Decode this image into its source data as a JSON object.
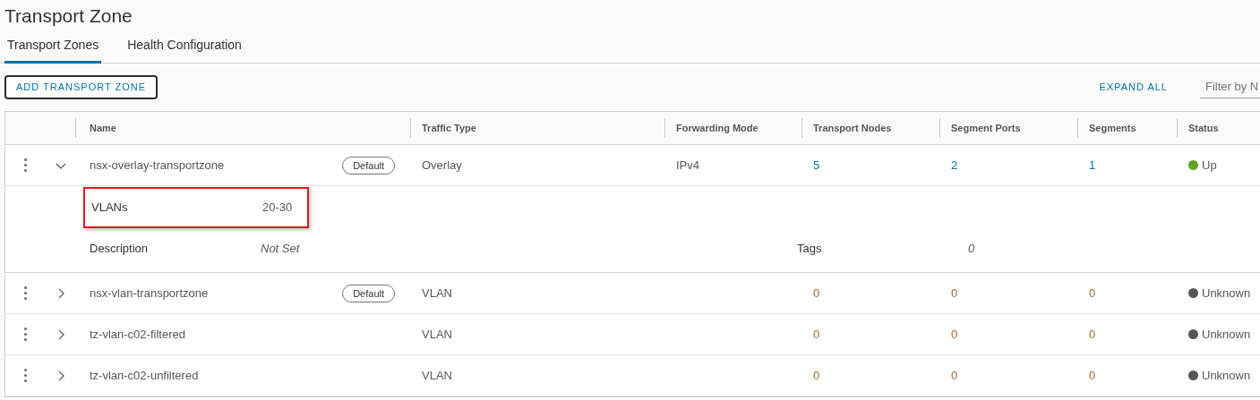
{
  "page": {
    "title": "Transport Zone"
  },
  "tabs": [
    {
      "label": "Transport Zones",
      "selected": true
    },
    {
      "label": "Health Configuration",
      "selected": false
    }
  ],
  "toolbar": {
    "add_button": "ADD TRANSPORT ZONE",
    "expand_all": "EXPAND ALL",
    "filter": {
      "placeholder": "Filter by N"
    }
  },
  "table": {
    "columns": [
      "Name",
      "Traffic Type",
      "Forwarding Mode",
      "Transport Nodes",
      "Segment Ports",
      "Segments",
      "Status"
    ],
    "rows": [
      {
        "name": "nsx-overlay-transportzone",
        "badge": "Default",
        "expanded": true,
        "traffic_type": "Overlay",
        "forwarding_mode": "IPv4",
        "transport_nodes": "5",
        "segment_ports": "2",
        "segments": "1",
        "counts_linked": true,
        "status": {
          "label": "Up",
          "color": "#62a420"
        },
        "detail_rows": [
          [
            {
              "label": "VLANs",
              "value": "20-30",
              "highlighted": true,
              "kind": "plain"
            }
          ],
          [
            {
              "label": "Description",
              "value": "Not Set",
              "highlighted": false,
              "kind": "unset"
            },
            {
              "label": "Tags",
              "value": "0",
              "highlighted": false,
              "kind": "unset"
            }
          ]
        ]
      },
      {
        "name": "nsx-vlan-transportzone",
        "badge": "Default",
        "expanded": false,
        "traffic_type": "VLAN",
        "transport_nodes": "0",
        "segment_ports": "0",
        "segments": "0",
        "counts_linked": false,
        "status": {
          "label": "Unknown",
          "color": "#565656"
        }
      },
      {
        "name": "tz-vlan-c02-filtered",
        "expanded": false,
        "traffic_type": "VLAN",
        "transport_nodes": "0",
        "segment_ports": "0",
        "segments": "0",
        "counts_linked": false,
        "status": {
          "label": "Unknown",
          "color": "#565656"
        }
      },
      {
        "name": "tz-vlan-c02-unfiltered",
        "expanded": false,
        "traffic_type": "VLAN",
        "transport_nodes": "0",
        "segment_ports": "0",
        "segments": "0",
        "counts_linked": false,
        "status": {
          "label": "Unknown",
          "color": "#565656"
        }
      }
    ]
  }
}
